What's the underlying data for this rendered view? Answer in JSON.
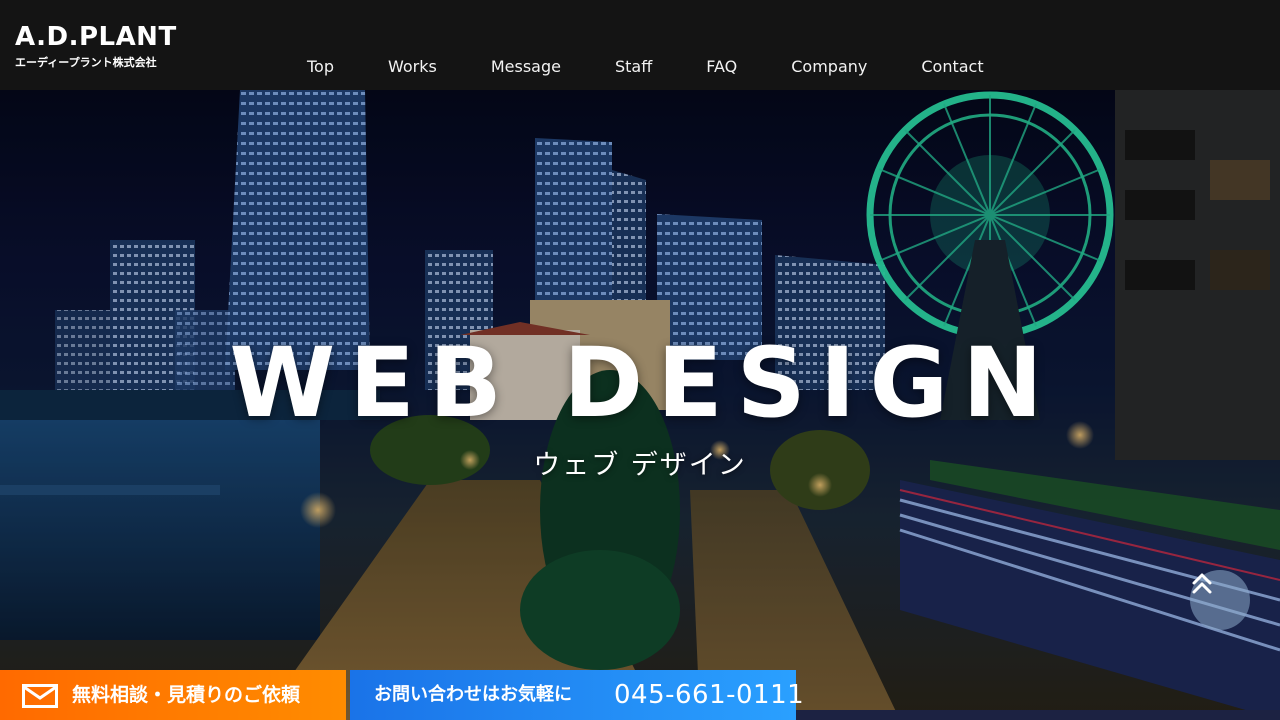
{
  "header": {
    "logo_main": "A.D.PLANT",
    "logo_sub": "エーディープラント株式会社"
  },
  "nav": {
    "items": [
      {
        "label": "Top"
      },
      {
        "label": "Works"
      },
      {
        "label": "Message"
      },
      {
        "label": "Staff"
      },
      {
        "label": "FAQ"
      },
      {
        "label": "Company"
      },
      {
        "label": "Contact"
      }
    ]
  },
  "hero": {
    "title": "WEB DESIGN",
    "subtitle": "ウェブ デザイン"
  },
  "cta": {
    "consult_label": "無料相談・見積りのご依頼",
    "tel_label": "お問い合わせはお気軽に",
    "tel_number": "045-661-0111"
  },
  "colors": {
    "header_bg": "#141414",
    "consult_bg": "#ff7a00",
    "tel_bg": "#1a8cf0",
    "ferris_wheel": "#2ee6b0"
  },
  "icons": {
    "mail": "mail-icon",
    "scroll_top": "double-chevron-up-icon"
  }
}
